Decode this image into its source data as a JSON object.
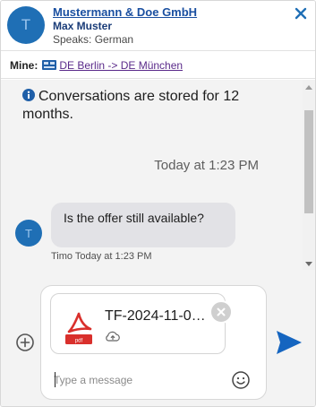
{
  "header": {
    "avatar_initial": "T",
    "company": "Mustermann & Doe GmbH",
    "contact_name": "Max Muster",
    "speaks": "Speaks: German"
  },
  "mine": {
    "label": "Mine:",
    "route": "DE Berlin -> DE München"
  },
  "messages": {
    "info": "Conversations are stored for 12 months.",
    "timestamp": "Today at 1:23 PM",
    "incoming": {
      "avatar_initial": "T",
      "text": "Is the offer still available?",
      "meta": "Timo Today at 1:23 PM"
    }
  },
  "composer": {
    "attachment_name": "TF-2024-11-0…",
    "pdf_label": "pdf",
    "placeholder": "Type a message"
  },
  "colors": {
    "brand_blue": "#1f6fb5",
    "link_blue": "#1a4fa0",
    "send_blue": "#1565c0",
    "pdf_red": "#d9302c"
  },
  "icons": [
    "close-icon",
    "route-icon",
    "info-icon",
    "pdf-icon",
    "cloud-icon",
    "remove-icon",
    "add-icon",
    "emoji-icon",
    "send-icon"
  ]
}
